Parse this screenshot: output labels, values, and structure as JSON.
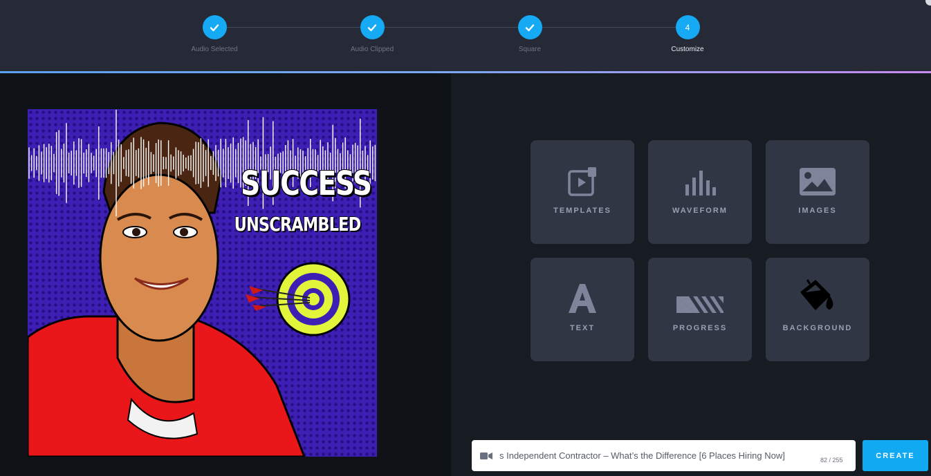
{
  "stepper": {
    "steps": [
      {
        "label": "Audio Selected",
        "state": "done",
        "icon": "check-icon"
      },
      {
        "label": "Audio Clipped",
        "state": "done",
        "icon": "check-icon"
      },
      {
        "label": "Square",
        "state": "done",
        "icon": "check-icon"
      },
      {
        "label": "Customize",
        "state": "active",
        "number": "4"
      }
    ]
  },
  "preview": {
    "title_line1": "SUCCESS",
    "title_line2": "UNSCRAMBLED"
  },
  "tools": [
    {
      "label": "TEMPLATES",
      "icon": "templates-icon"
    },
    {
      "label": "WAVEFORM",
      "icon": "waveform-icon"
    },
    {
      "label": "IMAGES",
      "icon": "images-icon"
    },
    {
      "label": "TEXT",
      "icon": "text-icon"
    },
    {
      "label": "PROGRESS",
      "icon": "progress-icon"
    },
    {
      "label": "BACKGROUND",
      "icon": "paint-bucket-icon"
    }
  ],
  "video_title": {
    "value": "s Independent Contractor – What’s the Difference [6 Places Hiring Now]",
    "counter": "82 / 255",
    "icon": "video-camera-icon"
  },
  "create_button": {
    "label": "CREATE"
  },
  "colors": {
    "accent": "#16aaf5",
    "header_bg": "#262a36",
    "tile_bg": "#313645",
    "preview_bg": "#3d1fb4"
  }
}
